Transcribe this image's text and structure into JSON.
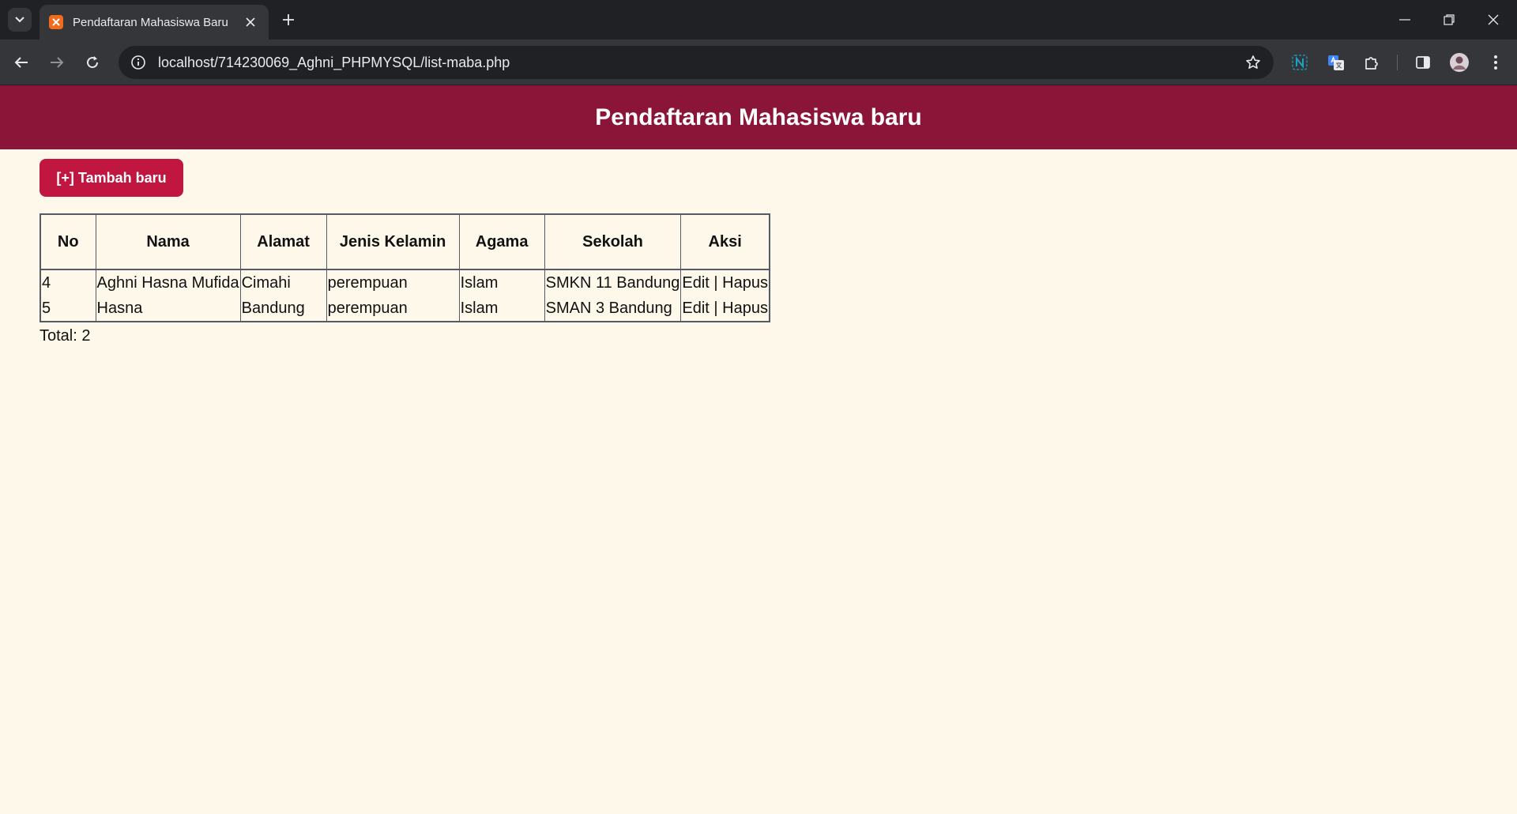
{
  "browser": {
    "tab_title": "Pendaftaran Mahasiswa Baru",
    "url": "localhost/714230069_Aghni_PHPMYSQL/list-maba.php"
  },
  "page": {
    "title": "Pendaftaran Mahasiswa baru",
    "add_button": "[+] Tambah baru",
    "total_label": "Total: 2"
  },
  "table": {
    "headers": {
      "no": "No",
      "nama": "Nama",
      "alamat": "Alamat",
      "jenis_kelamin": "Jenis Kelamin",
      "agama": "Agama",
      "sekolah": "Sekolah",
      "aksi": "Aksi"
    },
    "rows": [
      {
        "no": "4",
        "nama": "Aghni Hasna Mufida",
        "alamat": "Cimahi",
        "jenis_kelamin": "perempuan",
        "agama": "Islam",
        "sekolah": "SMKN 11 Bandung",
        "edit": "Edit",
        "sep": "|",
        "hapus": "Hapus"
      },
      {
        "no": "5",
        "nama": "Hasna",
        "alamat": "Bandung",
        "jenis_kelamin": "perempuan",
        "agama": "Islam",
        "sekolah": "SMAN 3 Bandung",
        "edit": "Edit",
        "sep": "|",
        "hapus": "Hapus"
      }
    ]
  },
  "colors": {
    "header_bg": "#8b1538",
    "button_bg": "#c0163f",
    "page_bg": "#fdf8e9"
  }
}
